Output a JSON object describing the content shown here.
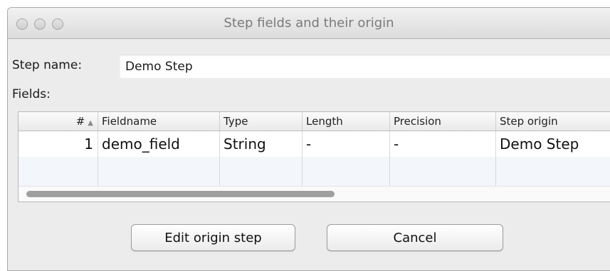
{
  "window": {
    "title": "Step fields and their origin"
  },
  "form": {
    "step_name_label": "Step name:",
    "step_name_value": "Demo Step",
    "fields_label": "Fields:"
  },
  "table": {
    "columns": [
      {
        "label": "#",
        "sort_icon": "▲"
      },
      {
        "label": "Fieldname"
      },
      {
        "label": "Type"
      },
      {
        "label": "Length"
      },
      {
        "label": "Precision"
      },
      {
        "label": "Step origin"
      }
    ],
    "rows": [
      [
        "1",
        "demo_field",
        "String",
        "-",
        "-",
        "Demo Step"
      ]
    ]
  },
  "buttons": {
    "edit_origin_step": "Edit origin step",
    "cancel": "Cancel"
  },
  "icons": {
    "window_controls": [
      "close-icon",
      "minimize-icon",
      "zoom-icon"
    ],
    "sort": "sort-ascending-icon"
  }
}
